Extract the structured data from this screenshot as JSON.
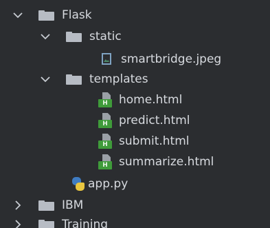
{
  "tree": {
    "items": [
      {
        "label": "Flask",
        "type": "folder",
        "expanded": true,
        "depth": 0
      },
      {
        "label": "static",
        "type": "folder",
        "expanded": true,
        "depth": 1
      },
      {
        "label": "smartbridge.jpeg",
        "type": "image-file",
        "depth": 2
      },
      {
        "label": "templates",
        "type": "folder",
        "expanded": true,
        "depth": 1
      },
      {
        "label": "home.html",
        "type": "html-file",
        "depth": 2
      },
      {
        "label": "predict.html",
        "type": "html-file",
        "depth": 2
      },
      {
        "label": "submit.html",
        "type": "html-file",
        "depth": 2
      },
      {
        "label": "summarize.html",
        "type": "html-file",
        "depth": 2
      },
      {
        "label": "app.py",
        "type": "python-file",
        "depth": 1
      },
      {
        "label": "IBM",
        "type": "folder",
        "expanded": false,
        "depth": 0
      },
      {
        "label": "Training",
        "type": "folder",
        "expanded": false,
        "depth": 0
      }
    ],
    "html_badge": "H"
  },
  "colors": {
    "background": "#2b2d30",
    "text": "#d7dadf",
    "folder": "#b7bcc4",
    "html_badge": "#3f9b3a",
    "python_blue": "#3f7cc2",
    "python_yellow": "#e9c640"
  }
}
